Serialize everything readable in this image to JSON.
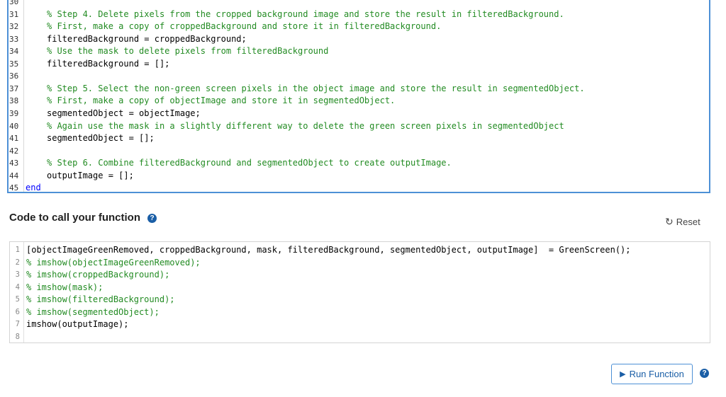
{
  "top_editor": {
    "lines": [
      {
        "num": "30",
        "code": "",
        "kind": "normal",
        "indent": 0
      },
      {
        "num": "31",
        "code": "% Step 4. Delete pixels from the cropped background image and store the result in filteredBackground.",
        "kind": "comment",
        "indent": 1
      },
      {
        "num": "32",
        "code": "% First, make a copy of croppedBackground and store it in filteredBackground.",
        "kind": "comment",
        "indent": 1
      },
      {
        "num": "33",
        "code": "filteredBackground = croppedBackground;",
        "kind": "normal",
        "indent": 1
      },
      {
        "num": "34",
        "code": "% Use the mask to delete pixels from filteredBackground",
        "kind": "comment",
        "indent": 1
      },
      {
        "num": "35",
        "code": "filteredBackground = [];",
        "kind": "normal",
        "indent": 1
      },
      {
        "num": "36",
        "code": "",
        "kind": "normal",
        "indent": 1
      },
      {
        "num": "37",
        "code": "% Step 5. Select the non-green screen pixels in the object image and store the result in segmentedObject.",
        "kind": "comment",
        "indent": 1
      },
      {
        "num": "38",
        "code": "% First, make a copy of objectImage and store it in segmentedObject.",
        "kind": "comment",
        "indent": 1
      },
      {
        "num": "39",
        "code": "segmentedObject = objectImage;",
        "kind": "normal",
        "indent": 1
      },
      {
        "num": "40",
        "code": "% Again use the mask in a slightly different way to delete the green screen pixels in segmentedObject",
        "kind": "comment",
        "indent": 1
      },
      {
        "num": "41",
        "code": "segmentedObject = [];",
        "kind": "normal",
        "indent": 1
      },
      {
        "num": "42",
        "code": "",
        "kind": "normal",
        "indent": 1
      },
      {
        "num": "43",
        "code": "% Step 6. Combine filteredBackground and segmentedObject to create outputImage.",
        "kind": "comment",
        "indent": 1
      },
      {
        "num": "44",
        "code": "outputImage = [];",
        "kind": "normal",
        "indent": 1
      },
      {
        "num": "45",
        "code": "end",
        "kind": "keyword",
        "indent": 0
      }
    ]
  },
  "call_section": {
    "title": "Code to call your function",
    "reset_label": "Reset",
    "run_label": "Run Function"
  },
  "bottom_editor": {
    "lines": [
      {
        "num": "1",
        "code": "[objectImageGreenRemoved, croppedBackground, mask, filteredBackground, segmentedObject, outputImage]  = GreenScreen();",
        "kind": "normal"
      },
      {
        "num": "2",
        "code": "% imshow(objectImageGreenRemoved);",
        "kind": "comment"
      },
      {
        "num": "3",
        "code": "% imshow(croppedBackground);",
        "kind": "comment"
      },
      {
        "num": "4",
        "code": "% imshow(mask);",
        "kind": "comment"
      },
      {
        "num": "5",
        "code": "% imshow(filteredBackground);",
        "kind": "comment"
      },
      {
        "num": "6",
        "code": "% imshow(segmentedObject);",
        "kind": "comment"
      },
      {
        "num": "7",
        "code": "imshow(outputImage);",
        "kind": "normal"
      },
      {
        "num": "8",
        "code": "",
        "kind": "normal"
      }
    ]
  },
  "icons": {
    "help": "question-circle-icon",
    "reset": "refresh-icon",
    "run": "play-triangle-icon"
  },
  "colors": {
    "accent": "#4d90d6",
    "comment": "#228b22",
    "keyword": "#0000ff"
  }
}
